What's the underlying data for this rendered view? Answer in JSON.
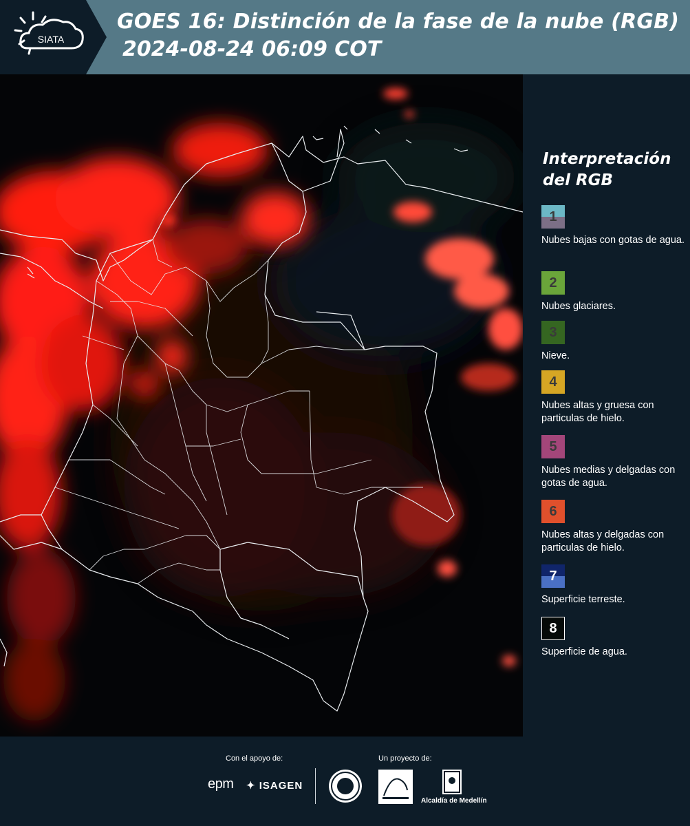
{
  "header": {
    "logo_text": "SIATA",
    "title_line1": "GOES 16: Distinción de la fase de la nube (RGB)",
    "title_line2": "2024-08-24 06:09 COT"
  },
  "legend": {
    "title": "Interpretación del RGB",
    "items": [
      {
        "number": "1",
        "label": "Nubes bajas con gotas de agua.",
        "color_top": "#6cb8c6",
        "color_bottom": "#7c6f86"
      },
      {
        "number": "2",
        "label": "Nubes glaciares.",
        "color_top": "#6aa53a",
        "color_bottom": "#6aa53a"
      },
      {
        "number": "3",
        "label": "Nieve.",
        "color_top": "#356621",
        "color_bottom": "#356621"
      },
      {
        "number": "4",
        "label": "Nubes altas y gruesa con particulas de hielo.",
        "color_top": "#d6a624",
        "color_bottom": "#d6a624"
      },
      {
        "number": "5",
        "label": "Nubes medias y delgadas con gotas de agua.",
        "color_top": "#a3467a",
        "color_bottom": "#a3467a"
      },
      {
        "number": "6",
        "label": "Nubes altas y delgadas con particulas de hielo.",
        "color_top": "#e0502c",
        "color_bottom": "#e0502c"
      },
      {
        "number": "7",
        "label": "Superficie terreste.",
        "color_top": "#10256a",
        "color_bottom": "#4a70c4"
      },
      {
        "number": "8",
        "label": "Superficie de agua.",
        "color_top": "#050a08",
        "color_bottom": "#050a08"
      }
    ]
  },
  "footer": {
    "support_label": "Con el apoyo de:",
    "project_label": "Un proyecto de:",
    "sponsor_1": "epm",
    "sponsor_2": "ISAGEN",
    "partner_3": "Alcaldía de Medellín"
  }
}
